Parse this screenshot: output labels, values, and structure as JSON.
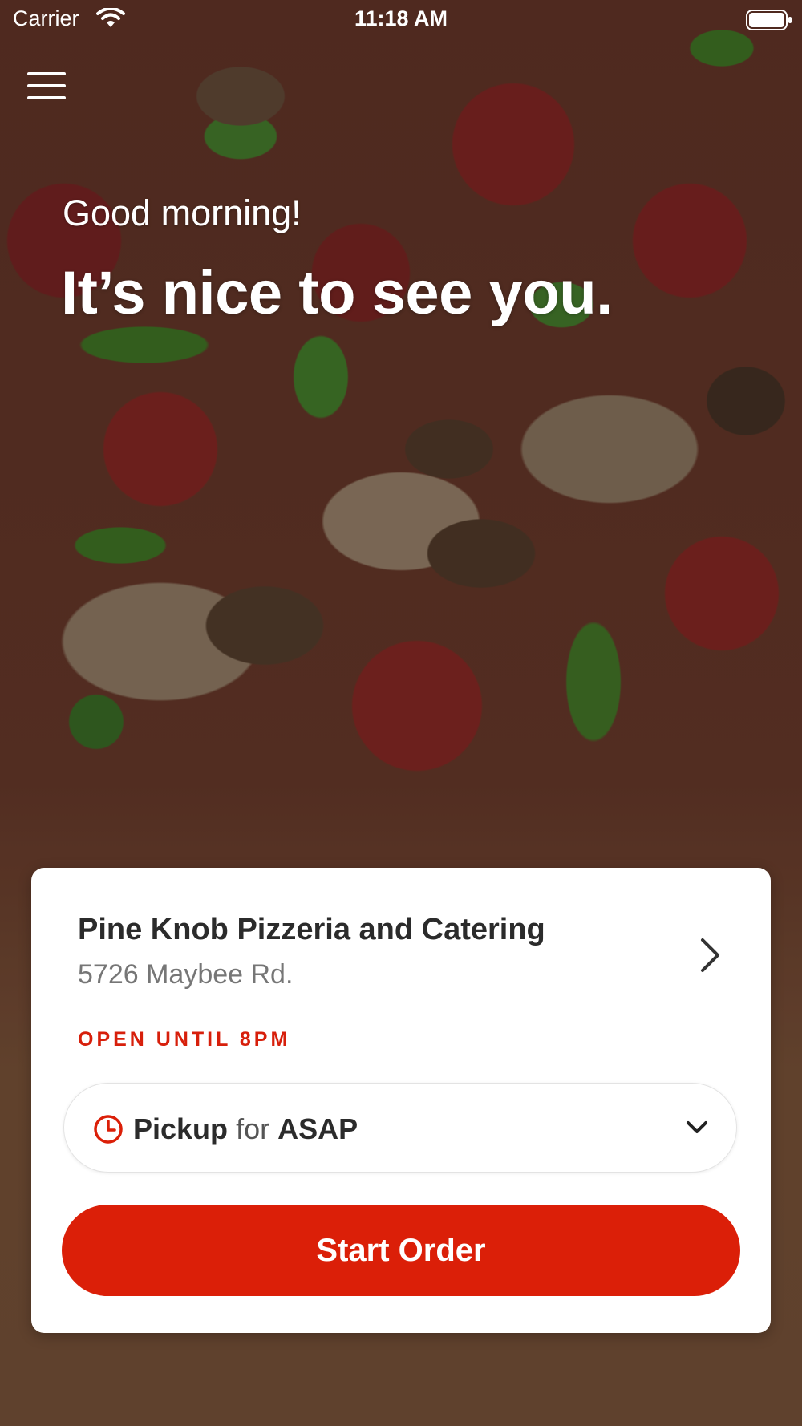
{
  "status_bar": {
    "carrier": "Carrier",
    "time": "11:18 AM"
  },
  "menu": {
    "icon": "hamburger-menu-icon"
  },
  "greeting": {
    "salutation": "Good morning!",
    "headline": "It’s nice to see you."
  },
  "store": {
    "name": "Pine Knob Pizzeria and Catering",
    "address": "5726 Maybee Rd.",
    "hours_status": "OPEN UNTIL 8PM"
  },
  "fulfillment": {
    "icon": "clock-icon",
    "mode": "Pickup",
    "connector": "for",
    "time": "ASAP"
  },
  "actions": {
    "start_order": "Start Order"
  },
  "colors": {
    "accent": "#db1f08",
    "hours_text": "#d71f0b",
    "card_bg": "#ffffff"
  }
}
